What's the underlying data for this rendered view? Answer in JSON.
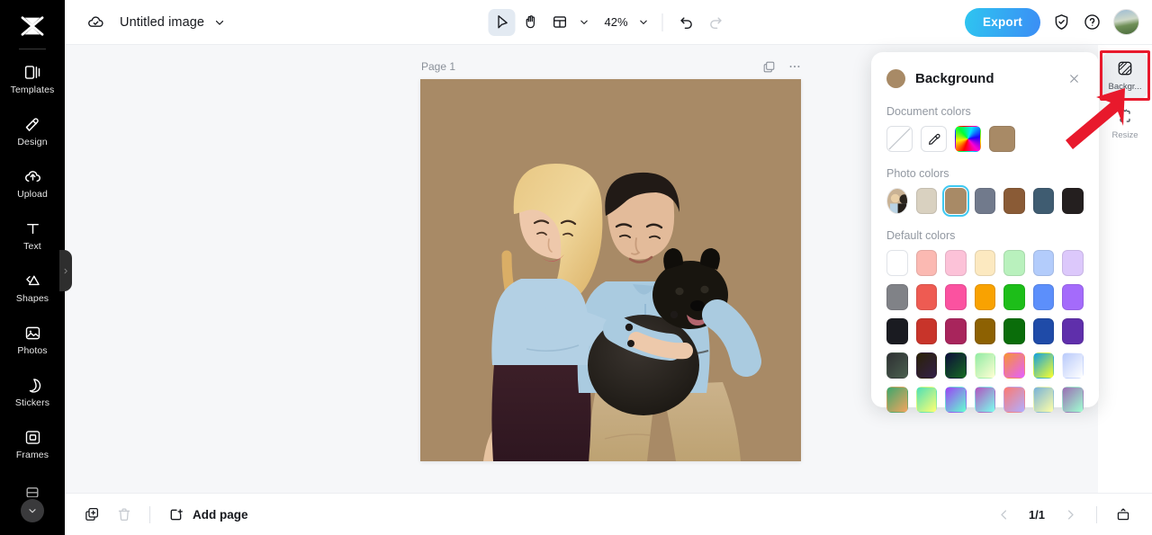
{
  "app": {
    "brand_icon": "capcut-logo-icon",
    "doc_title": "Untitled image",
    "cloud_status_icon": "cloud-saved-icon"
  },
  "sidebar": {
    "items": [
      {
        "label": "Templates",
        "icon": "templates-icon"
      },
      {
        "label": "Design",
        "icon": "design-icon"
      },
      {
        "label": "Upload",
        "icon": "upload-cloud-icon"
      },
      {
        "label": "Text",
        "icon": "text-icon"
      },
      {
        "label": "Shapes",
        "icon": "shapes-icon"
      },
      {
        "label": "Photos",
        "icon": "photos-icon"
      },
      {
        "label": "Stickers",
        "icon": "stickers-icon"
      },
      {
        "label": "Frames",
        "icon": "frames-icon"
      }
    ],
    "more_icon": "chevron-down-icon",
    "collapse_handle_icon": "chevron-right-icon"
  },
  "toolbar": {
    "select_tool_icon": "cursor-arrow-icon",
    "hand_tool_icon": "hand-icon",
    "layout_tool_icon": "layout-grid-icon",
    "layout_caret_icon": "chevron-down-icon",
    "zoom_level": "42%",
    "zoom_caret_icon": "chevron-down-icon",
    "undo_icon": "undo-icon",
    "redo_icon": "redo-icon",
    "export_label": "Export",
    "shield_icon": "shield-check-icon",
    "help_icon": "help-circle-icon",
    "avatar_icon": "user-avatar"
  },
  "canvas": {
    "page_label": "Page 1",
    "duplicate_icon": "duplicate-page-icon",
    "more_icon": "more-horizontal-icon",
    "background_color": "#a88a66",
    "artwork": "couple-with-french-bulldog-photo"
  },
  "background_panel": {
    "title": "Background",
    "current_color": "#a88a66",
    "close_icon": "close-icon",
    "sections": {
      "document": {
        "title": "Document colors",
        "swatches": [
          {
            "name": "transparent-swatch",
            "kind": "transparent"
          },
          {
            "name": "eyedropper-swatch",
            "kind": "eyedropper"
          },
          {
            "name": "rainbow-picker-swatch",
            "kind": "rainbow"
          },
          {
            "name": "document-color-1",
            "kind": "solid",
            "color": "#a88a66"
          }
        ]
      },
      "photo": {
        "title": "Photo colors",
        "thumbnail": "photo-thumbnail",
        "swatches": [
          {
            "color": "#d9d1c0",
            "selected": false
          },
          {
            "color": "#a88a66",
            "selected": true
          },
          {
            "color": "#717a8c",
            "selected": false
          },
          {
            "color": "#8a5b36",
            "selected": false
          },
          {
            "color": "#3f5c71",
            "selected": false
          },
          {
            "color": "#241f1f",
            "selected": false
          }
        ]
      },
      "default": {
        "title": "Default colors",
        "rows": [
          [
            "#ffffff",
            "#fbb9b2",
            "#fcc2d8",
            "#fce9c0",
            "#b9f1bd",
            "#b3ccfb",
            "#dcc8fb"
          ],
          [
            "#808287",
            "#ee5b52",
            "#fb52a0",
            "#f9a201",
            "#1dbe19",
            "#5c8ffb",
            "#a46bfb"
          ],
          [
            "#1a1b21",
            "#c8342a",
            "#a8255c",
            "#8d6102",
            "#0a6d0a",
            "#1f4ba8",
            "#5f2fab"
          ],
          [
            "#2e3033",
            "#2a2107",
            "#0d0e3a",
            "#92eba4",
            "#f79334",
            "#15a1dd",
            "#b9cafb"
          ],
          [
            "#3fa76c",
            "#4fe0b6",
            "#9a44f4",
            "#b054c0",
            "#fb7a72",
            "#79b3d8",
            "#9a6eb4"
          ]
        ]
      }
    }
  },
  "right_rail": {
    "items": [
      {
        "label": "Backgr...",
        "icon": "background-icon",
        "active": true
      },
      {
        "label": "Resize",
        "icon": "resize-icon",
        "active": false
      }
    ],
    "highlight_color": "#e8192c",
    "annotation_icon": "red-arrow-annotation"
  },
  "bottom_bar": {
    "duplicate_icon": "duplicate-page-icon",
    "delete_icon": "trash-icon",
    "add_page_label": "Add page",
    "add_page_icon": "add-page-icon",
    "prev_icon": "chevron-left-icon",
    "page_indicator": "1/1",
    "next_icon": "chevron-right-icon",
    "present_icon": "present-icon"
  }
}
